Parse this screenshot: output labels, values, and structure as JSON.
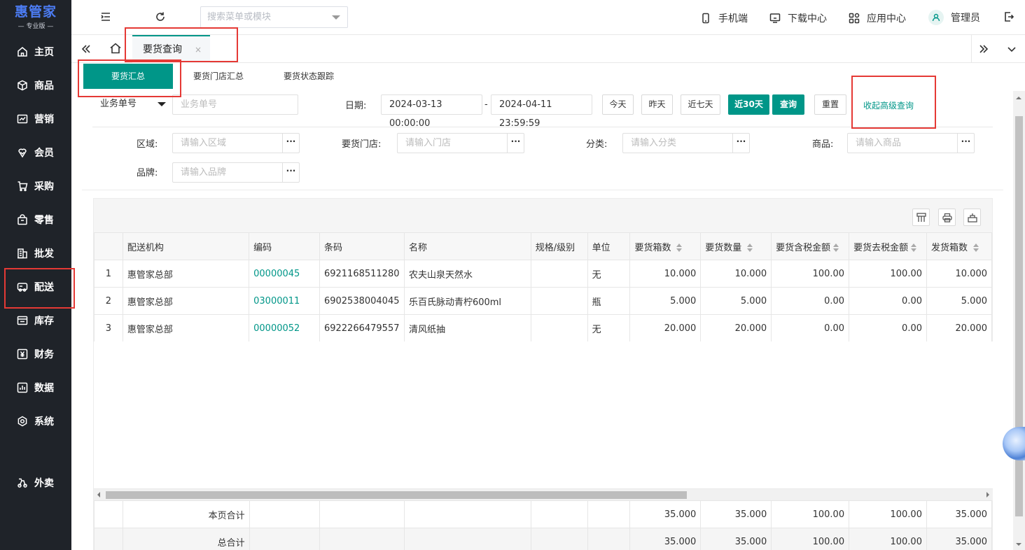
{
  "app": {
    "title": "惠管家",
    "edition": "— 专业版 —"
  },
  "sidebar": {
    "items": [
      {
        "label": "主页",
        "icon": "home-icon"
      },
      {
        "label": "商品",
        "icon": "box-icon"
      },
      {
        "label": "营销",
        "icon": "chart-icon"
      },
      {
        "label": "会员",
        "icon": "diamond-icon"
      },
      {
        "label": "采购",
        "icon": "cart-icon"
      },
      {
        "label": "零售",
        "icon": "bag-icon"
      },
      {
        "label": "批发",
        "icon": "building-icon"
      },
      {
        "label": "配送",
        "icon": "truck-icon"
      },
      {
        "label": "库存",
        "icon": "warehouse-icon"
      },
      {
        "label": "财务",
        "icon": "yen-icon"
      },
      {
        "label": "数据",
        "icon": "data-icon"
      },
      {
        "label": "系统",
        "icon": "settings-icon"
      },
      {
        "label": "外卖",
        "icon": "delivery-icon"
      }
    ]
  },
  "header": {
    "search_placeholder": "搜索菜单或模块",
    "mobile": "手机端",
    "download": "下载中心",
    "apps": "应用中心",
    "user": "管理员"
  },
  "tabs": {
    "active": "要货查询",
    "close": "×"
  },
  "subtabs": [
    "要货汇总",
    "要货门店汇总",
    "要货状态跟踪"
  ],
  "filters": {
    "doc_type": "业务单号",
    "doc_placeholder": "业务单号",
    "date_label": "日期:",
    "date_start": "2024-03-13 00:00:00",
    "date_sep": "-",
    "date_end": "2024-04-11 23:59:59",
    "btn_today": "今天",
    "btn_yesterday": "昨天",
    "btn_7days": "近七天",
    "btn_30days": "近30天",
    "btn_query": "查询",
    "btn_reset": "重置",
    "btn_collapse": "收起高级查询",
    "region_label": "区域:",
    "region_placeholder": "请输入区域",
    "store_label": "要货门店:",
    "store_placeholder": "请输入门店",
    "category_label": "分类:",
    "category_placeholder": "请输入分类",
    "product_label": "商品:",
    "product_placeholder": "请输入商品",
    "brand_label": "品牌:",
    "brand_placeholder": "请输入品牌",
    "more": "···"
  },
  "table": {
    "columns": [
      "",
      "配送机构",
      "编码",
      "条码",
      "名称",
      "规格/级别",
      "单位",
      "要货箱数",
      "要货数量",
      "要货含税金额",
      "要货去税金额",
      "发货箱数"
    ],
    "rows": [
      [
        "1",
        "惠管家总部",
        "00000045",
        "6921168511280",
        "农夫山泉天然水",
        "",
        "无",
        "10.000",
        "10.000",
        "100.00",
        "100.00",
        "10.000"
      ],
      [
        "2",
        "惠管家总部",
        "03000011",
        "6902538004045",
        "乐百氏脉动青柠600ml",
        "",
        "瓶",
        "5.000",
        "5.000",
        "0.00",
        "0.00",
        "5.000"
      ],
      [
        "3",
        "惠管家总部",
        "00000052",
        "6922266479557",
        "清风纸抽",
        "",
        "无",
        "20.000",
        "20.000",
        "0.00",
        "0.00",
        "20.000"
      ]
    ],
    "page_total_label": "本页合计",
    "page_total": [
      "35.000",
      "35.000",
      "100.00",
      "100.00",
      "35.000"
    ],
    "grand_total_label": "总合计",
    "grand_total": [
      "35.000",
      "35.000",
      "100.00",
      "100.00",
      "35.000"
    ]
  },
  "colors": {
    "accent": "#009688",
    "sidebar_bg": "#1f2329",
    "highlight": "#e53935"
  }
}
